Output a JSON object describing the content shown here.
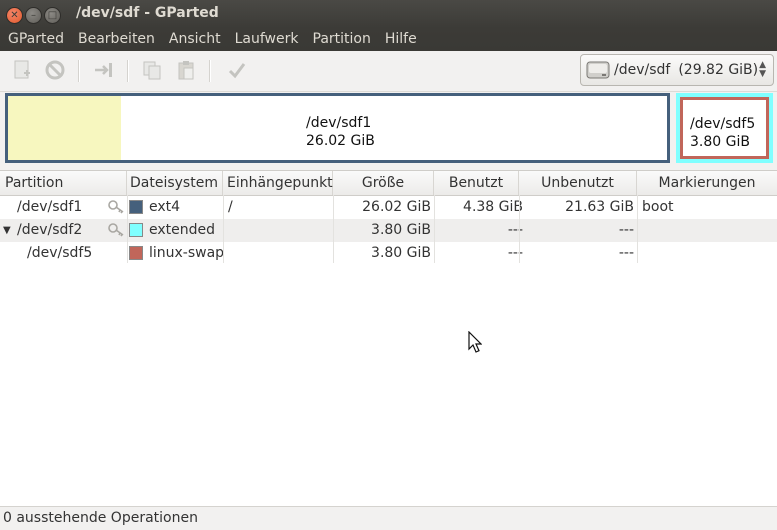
{
  "window": {
    "title": "/dev/sdf - GParted"
  },
  "menubar": {
    "items": [
      "GParted",
      "Bearbeiten",
      "Ansicht",
      "Laufwerk",
      "Partition",
      "Hilfe"
    ]
  },
  "toolbar": {
    "buttons": [
      "new-icon",
      "delete-icon",
      "resize-move-icon",
      "copy-icon",
      "paste-icon",
      "apply-icon"
    ]
  },
  "device": {
    "name": "/dev/sdf",
    "size": "(29.82 GiB)"
  },
  "visual": {
    "sdf1": {
      "name": "/dev/sdf1",
      "size": "26.02 GiB"
    },
    "sdf5": {
      "name": "/dev/sdf5",
      "size": "3.80 GiB"
    }
  },
  "table": {
    "headers": [
      "Partition",
      "Dateisystem",
      "Einhängepunkt",
      "Größe",
      "Benutzt",
      "Unbenutzt",
      "Markierungen"
    ],
    "rows": [
      {
        "partition": "/dev/sdf1",
        "filesystem": "ext4",
        "mount": "/",
        "size": "26.02 GiB",
        "used": "4.38 GiB",
        "unused": "21.63 GiB",
        "flags": "boot"
      },
      {
        "partition": "/dev/sdf2",
        "filesystem": "extended",
        "mount": "",
        "size": "3.80 GiB",
        "used": "---",
        "unused": "---",
        "flags": ""
      },
      {
        "partition": "/dev/sdf5",
        "filesystem": "linux-swap",
        "mount": "",
        "size": "3.80 GiB",
        "used": "---",
        "unused": "---",
        "flags": ""
      }
    ]
  },
  "colors": {
    "ext4": "#45607c",
    "extended": "#80ffff",
    "linux-swap": "#c1665a",
    "used": "#f7f7bf"
  },
  "status": {
    "text": "0 ausstehende Operationen"
  }
}
